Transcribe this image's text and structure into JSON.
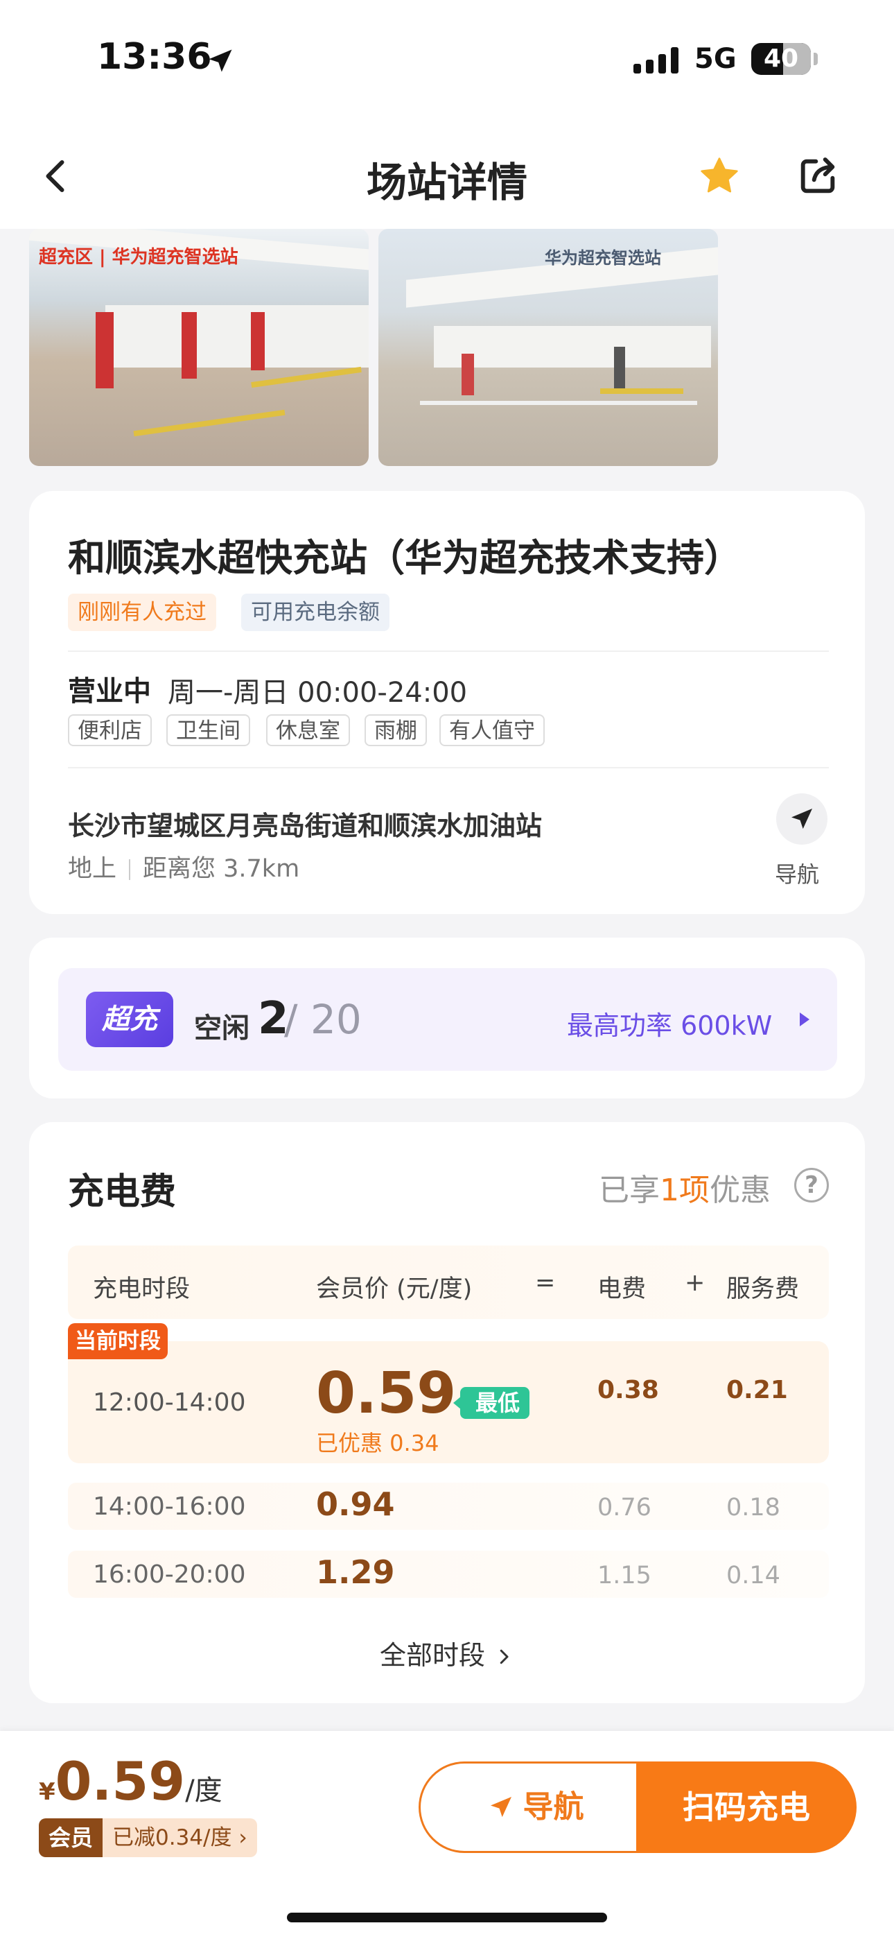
{
  "status": {
    "time": "13:36",
    "network": "5G",
    "battery": "40"
  },
  "header": {
    "title": "场站详情"
  },
  "photos": [
    {
      "sign": "超充区 | 华为超充智选站"
    },
    {
      "sign": "华为超充智选站"
    }
  ],
  "station": {
    "name": "和顺滨水超快充站（华为超充技术支持）",
    "tags": [
      "刚刚有人充过",
      "可用充电余额"
    ],
    "open_status": "营业中",
    "hours": "周一-周日 00:00-24:00",
    "amenities": [
      "便利店",
      "卫生间",
      "休息室",
      "雨棚",
      "有人值守"
    ],
    "address": "长沙市望城区月亮岛街道和顺滨水加油站",
    "floor": "地上",
    "distance": "距离您 3.7km",
    "nav_label": "导航"
  },
  "supercharge": {
    "badge": "超充",
    "idle_label": "空闲",
    "idle": "2",
    "total": "/ 20",
    "max_power": "最高功率 600kW"
  },
  "pricing": {
    "title": "充电费",
    "discount_prefix": "已享",
    "discount_count": "1项",
    "discount_suffix": "优惠",
    "help_icon": "?",
    "columns": [
      "充电时段",
      "会员价 (元/度)",
      "=",
      "电费",
      "+",
      "服务费"
    ],
    "current_label": "当前时段",
    "lowest_label": "最低",
    "current": {
      "time": "12:00-14:00",
      "price": "0.59",
      "saved": "已优惠 0.34",
      "fee": "0.38",
      "service": "0.21"
    },
    "rows": [
      {
        "time": "14:00-16:00",
        "price": "0.94",
        "fee": "0.76",
        "service": "0.18"
      },
      {
        "time": "16:00-20:00",
        "price": "1.29",
        "fee": "1.15",
        "service": "0.14"
      }
    ],
    "all_periods": "全部时段"
  },
  "bottom": {
    "currency": "¥",
    "price": "0.59",
    "unit": "/度",
    "member_label": "会员",
    "member_discount": "已减0.34/度",
    "nav_button": "导航",
    "scan_button": "扫码充电"
  },
  "colors": {
    "accent": "#f87a16",
    "brand_brown": "#8c4a18",
    "super_purple": "#6a4ee6",
    "lowest_green": "#2ec596"
  }
}
